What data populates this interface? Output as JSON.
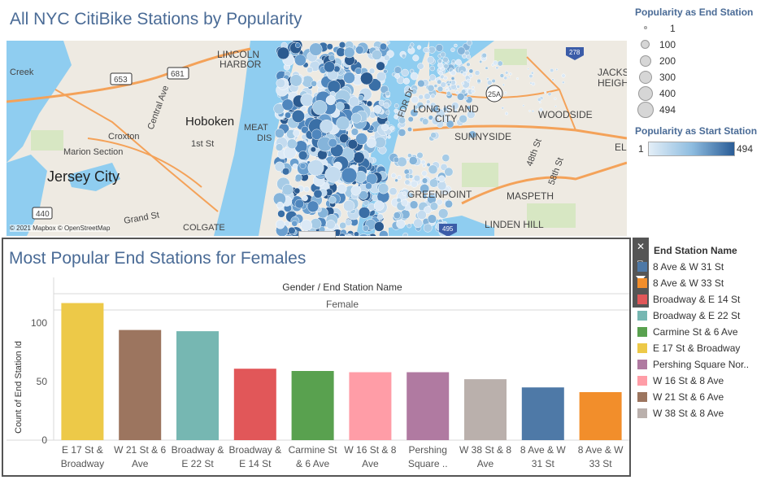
{
  "dashboard": {
    "map_title": "All NYC CitiBike Stations by Popularity",
    "chart_title": "Most Popular End Stations for Females"
  },
  "map": {
    "attribution": "© 2021 Mapbox © OpenStreetMap",
    "labels": [
      "Creek",
      "653",
      "681",
      "LINCOLN",
      "HARBOR",
      "Central Ave",
      "Hoboken",
      "Croxton",
      "1st St",
      "Marion Section",
      "Jersey City",
      "MEAT",
      "DIS",
      "Grand St",
      "COLGATE",
      "440",
      "FDR Dr",
      "LONG ISLAND",
      "CITY",
      "SUNNYSIDE",
      "WOODSIDE",
      "JACKS",
      "HEIGH",
      "278",
      "25A",
      "48th St",
      "58th St",
      "GREENPOINT",
      "MASPETH",
      "LINDEN HILL",
      "495",
      "ELI"
    ]
  },
  "legend_end": {
    "title": "Popularity as End Station",
    "items": [
      "1",
      "100",
      "200",
      "300",
      "400",
      "494"
    ]
  },
  "legend_start": {
    "title": "Popularity as Start Station",
    "min": "1",
    "max": "494"
  },
  "chart_header": {
    "line1": "Gender / End Station Name",
    "line2": "Female"
  },
  "legend_stations": {
    "title": "End Station Name",
    "items": [
      {
        "label": "8 Ave & W 31 St",
        "color": "#4e79a7"
      },
      {
        "label": "8 Ave & W 33 St",
        "color": "#f28e2b"
      },
      {
        "label": "Broadway & E 14 St",
        "color": "#e15759"
      },
      {
        "label": "Broadway & E 22 St",
        "color": "#76b7b2"
      },
      {
        "label": "Carmine St & 6 Ave",
        "color": "#59a14f"
      },
      {
        "label": "E 17 St & Broadway",
        "color": "#edc948"
      },
      {
        "label": "Pershing Square Nor..",
        "color": "#b07aa1"
      },
      {
        "label": "W 16 St & 8 Ave",
        "color": "#ff9da7"
      },
      {
        "label": "W 21 St & 6 Ave",
        "color": "#9c755f"
      },
      {
        "label": "W 38 St & 8 Ave",
        "color": "#bab0ac"
      }
    ]
  },
  "chart_data": {
    "type": "bar",
    "title": "Most Popular End Stations for Females",
    "xlabel": "Gender / End Station Name",
    "ylabel": "Count of End Station Id",
    "ylim": [
      0,
      125
    ],
    "yticks": [
      0,
      50,
      100
    ],
    "categories": [
      "E 17 St & Broadway",
      "W 21 St & 6 Ave",
      "Broadway & E 22 St",
      "Broadway & E 14 St",
      "Carmine St & 6 Ave",
      "W 16 St & 8 Ave",
      "Pershing Square ..",
      "W 38 St & 8 Ave",
      "8 Ave & W 31 St",
      "8 Ave & W 33 St"
    ],
    "values": [
      117,
      94,
      93,
      61,
      59,
      58,
      58,
      52,
      45,
      41
    ],
    "colors": [
      "#edc948",
      "#9c755f",
      "#76b7b2",
      "#e15759",
      "#59a14f",
      "#ff9da7",
      "#b07aa1",
      "#bab0ac",
      "#4e79a7",
      "#f28e2b"
    ],
    "tick_labels": [
      [
        "E 17 St &",
        "Broadway"
      ],
      [
        "W 21 St & 6",
        "Ave"
      ],
      [
        "Broadway &",
        "E 22 St"
      ],
      [
        "Broadway &",
        "E 14 St"
      ],
      [
        "Carmine St",
        "& 6 Ave"
      ],
      [
        "W 16 St & 8",
        "Ave"
      ],
      [
        "Pershing",
        "Square .."
      ],
      [
        "W 38 St & 8",
        "Ave"
      ],
      [
        "8 Ave & W",
        "31 St"
      ],
      [
        "8 Ave & W",
        "33 St"
      ]
    ],
    "grid": false,
    "legend": "right"
  }
}
